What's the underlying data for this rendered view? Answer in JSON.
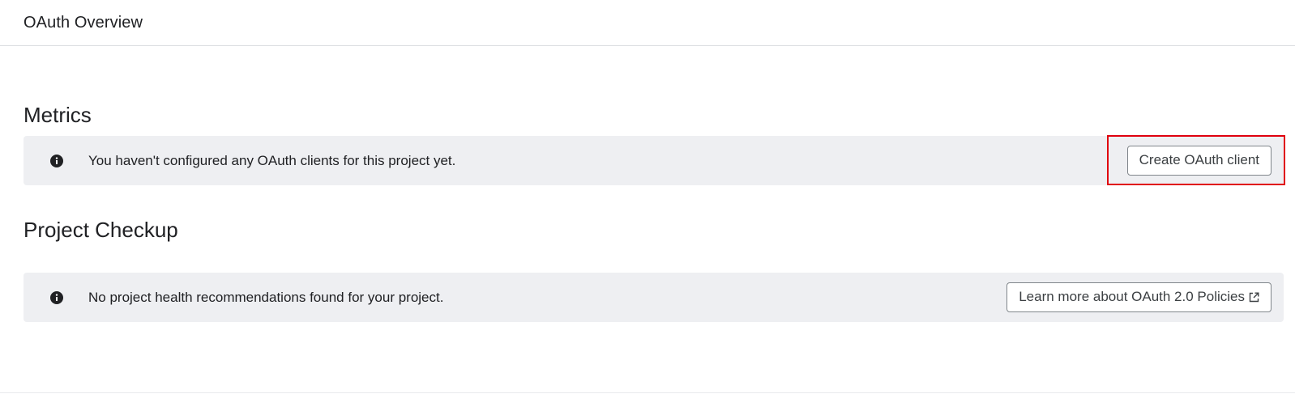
{
  "header": {
    "title": "OAuth Overview"
  },
  "metrics": {
    "title": "Metrics",
    "banner_text": "You haven't configured any OAuth clients for this project yet.",
    "button_label": "Create OAuth client",
    "icon": "info-icon"
  },
  "checkup": {
    "title": "Project Checkup",
    "banner_text": "No project health recommendations found for your project.",
    "button_label": "Learn more about OAuth 2.0 Policies",
    "icon": "info-icon",
    "button_icon": "external-link-icon"
  },
  "colors": {
    "banner_bg": "#eeeff2",
    "highlight": "#e0000e",
    "text": "#202124",
    "button_border": "#80868b"
  }
}
